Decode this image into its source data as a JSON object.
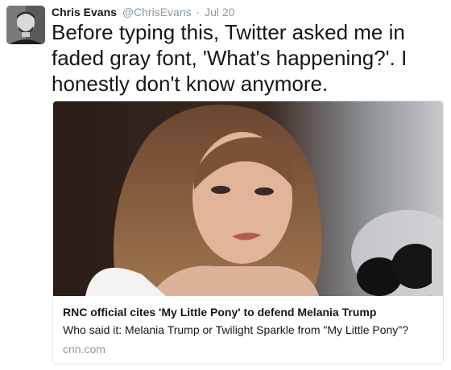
{
  "tweet": {
    "author": {
      "display_name": "Chris Evans",
      "handle": "@ChrisEvans",
      "separator": "·",
      "date": "Jul 20"
    },
    "text": "Before typing this, Twitter asked me in faded gray font, 'What's happening?'. I honestly don't know anymore.",
    "card": {
      "title": "RNC official cites 'My Little Pony' to defend Melania Trump",
      "description": "Who said it: Melania Trump or Twilight Sparkle from \"My Little Pony\"?",
      "domain": "cnn.com"
    }
  },
  "colors": {
    "text": "#14171a",
    "secondary": "#8899a6",
    "card_border": "#e1e8ed"
  }
}
